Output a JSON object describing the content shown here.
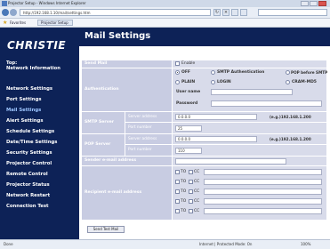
{
  "browser": {
    "title": "Projector Setup - Windows Internet Explorer",
    "address": "http://192.168.1.10/mail/settings.htm",
    "favorites_label": "Favorites",
    "tab_label": "Projector Setup",
    "status_left": "Done",
    "status_center": "Internet | Protected Mode: On",
    "status_right": "100%"
  },
  "sidebar": {
    "logo": "CHRISTIE",
    "top_link_line1": "Top:",
    "top_link_line2": "Network Information",
    "items": [
      {
        "label": "Network Settings"
      },
      {
        "label": "Port Settings"
      },
      {
        "label": "Mail Settings"
      },
      {
        "label": "Alert Settings"
      },
      {
        "label": "Schedule Settings"
      },
      {
        "label": "Date/Time Settings"
      },
      {
        "label": "Security Settings"
      },
      {
        "label": "Projector Control"
      },
      {
        "label": "Remote Control"
      },
      {
        "label": "Projector Status"
      },
      {
        "label": "Network Restart"
      },
      {
        "label": "Connection Test"
      }
    ],
    "active_index": 2
  },
  "page": {
    "title": "Mail Settings"
  },
  "form": {
    "send_mail": {
      "label": "Send Mail",
      "option": "Enable"
    },
    "authentication": {
      "label": "Authentication",
      "options": [
        "OFF",
        "SMTP Authentication",
        "POP before SMTP"
      ],
      "selected": "OFF",
      "sub_options": [
        "PLAIN",
        "LOGIN",
        "CRAM-MD5"
      ],
      "user_name_label": "User name",
      "user_name": "",
      "password_label": "Password",
      "password": ""
    },
    "smtp_server": {
      "label": "SMTP Server",
      "address_label": "Server address",
      "address": "0.0.0.0",
      "address_hint": "(e.g.)192.168.1.200",
      "port_label": "Port number",
      "port": "25"
    },
    "pop_server": {
      "label": "POP Server",
      "address_label": "Server address",
      "address": "0.0.0.0",
      "address_hint": "(e.g.)192.168.1.200",
      "port_label": "Port number",
      "port": "110"
    },
    "sender_email": {
      "label": "Sender e-mail address",
      "value": ""
    },
    "recipient_email": {
      "label": "Recipient e-mail address",
      "rows": [
        {
          "to": "TO",
          "cc": "CC",
          "value": ""
        },
        {
          "to": "TO",
          "cc": "CC",
          "value": ""
        },
        {
          "to": "TO",
          "cc": "CC",
          "value": ""
        },
        {
          "to": "TO",
          "cc": "CC",
          "value": ""
        },
        {
          "to": "TO",
          "cc": "CC",
          "value": ""
        }
      ]
    },
    "send_button": "Send Test Mail"
  }
}
